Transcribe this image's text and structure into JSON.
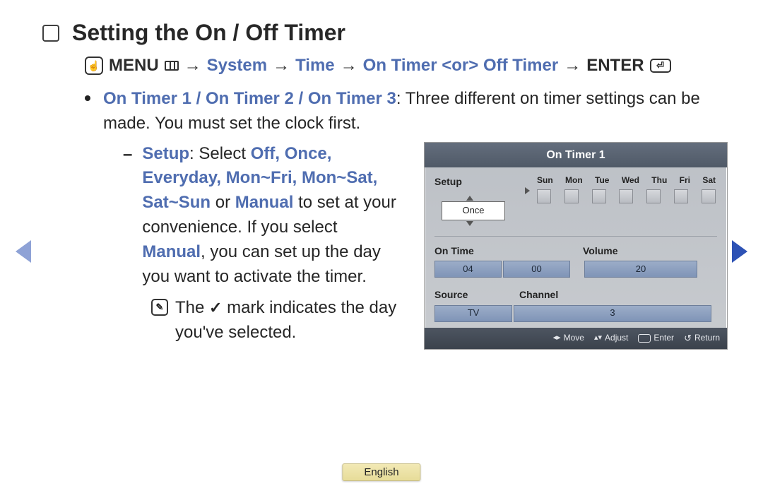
{
  "heading": "Setting the On / Off Timer",
  "crumb": {
    "menu": "MENU",
    "steps": [
      "System",
      "Time"
    ],
    "step_alt": "On Timer <or> Off Timer",
    "enter": "ENTER"
  },
  "bullet": {
    "title": "On Timer 1 / On Timer 2 / On Timer 3",
    "rest": ": Three different on timer settings can be made. You must set the clock first."
  },
  "setup_para": {
    "label": "Setup",
    "select_word": ": Select ",
    "options": "Off, Once, Everyday, Mon~Fri, Mon~Sat, Sat~Sun",
    "or_word": " or ",
    "manual": "Manual",
    "tail1": " to set at your convenience. If you select ",
    "tail2": ", you can set up the day you want to activate the timer."
  },
  "note": {
    "pre": "The ",
    "post": " mark indicates the day you've selected."
  },
  "osd": {
    "title": "On Timer 1",
    "setup_label": "Setup",
    "setup_value": "Once",
    "days": [
      "Sun",
      "Mon",
      "Tue",
      "Wed",
      "Thu",
      "Fri",
      "Sat"
    ],
    "ontime_label": "On Time",
    "volume_label": "Volume",
    "ontime_h": "04",
    "ontime_m": "00",
    "volume_val": "20",
    "source_label": "Source",
    "channel_label": "Channel",
    "source_val": "TV",
    "channel_val": "3",
    "footer": {
      "move": "Move",
      "adjust": "Adjust",
      "enter": "Enter",
      "ret": "Return"
    }
  },
  "lang": "English"
}
